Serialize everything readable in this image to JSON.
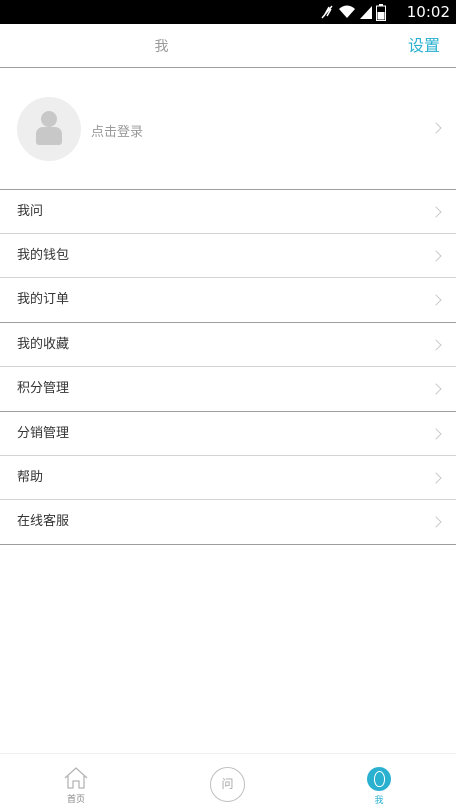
{
  "status_bar": {
    "time": "10:02"
  },
  "header": {
    "title": "我",
    "settings_label": "设置"
  },
  "profile": {
    "login_text": "点击登录"
  },
  "menu": {
    "items": [
      {
        "label": "我问"
      },
      {
        "label": "我的钱包"
      },
      {
        "label": "我的订单"
      },
      {
        "label": "我的收藏"
      },
      {
        "label": "积分管理"
      },
      {
        "label": "分销管理"
      },
      {
        "label": "帮助"
      },
      {
        "label": "在线客服"
      }
    ]
  },
  "tabbar": {
    "home_label": "首页",
    "ask_icon_text": "问",
    "me_label": "我",
    "active_color": "#2ab1cf"
  }
}
